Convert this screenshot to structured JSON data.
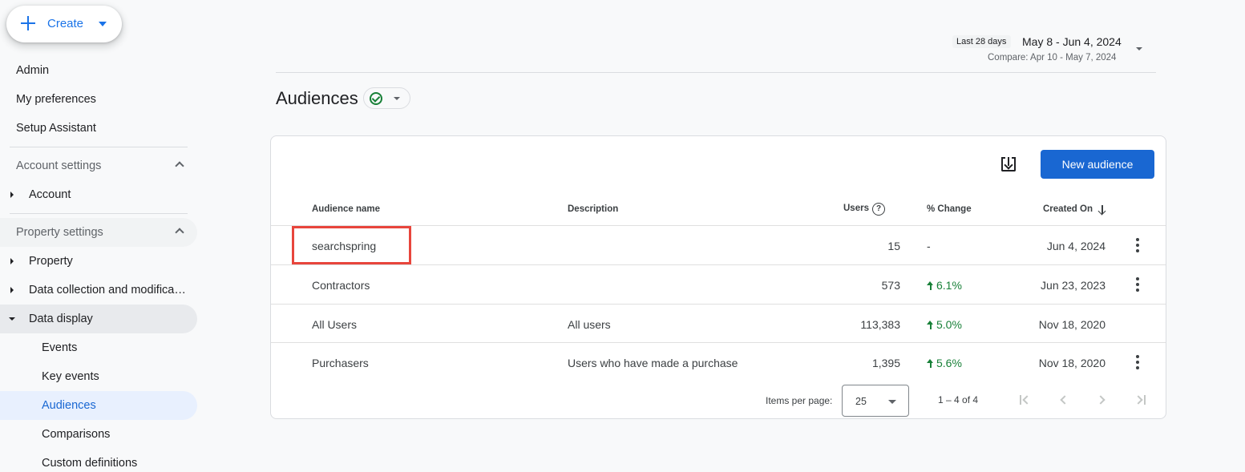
{
  "create": {
    "label": "Create"
  },
  "sidebar": {
    "top_items": [
      "Admin",
      "My preferences",
      "Setup Assistant"
    ],
    "account_settings": {
      "label": "Account settings",
      "items": [
        "Account"
      ]
    },
    "property_settings": {
      "label": "Property settings",
      "items": [
        "Property",
        "Data collection and modifica…",
        "Data display"
      ],
      "data_display_items": [
        "Events",
        "Key events",
        "Audiences",
        "Comparisons",
        "Custom definitions"
      ]
    }
  },
  "date": {
    "chip": "Last 28 days",
    "range": "May 8 - Jun 4, 2024",
    "compare": "Compare: Apr 10 - May 7, 2024"
  },
  "page": {
    "title": "Audiences"
  },
  "card": {
    "new_button": "New audience",
    "columns": {
      "name": "Audience name",
      "description": "Description",
      "users": "Users",
      "change": "% Change",
      "created": "Created On"
    },
    "help_glyph": "?",
    "rows": [
      {
        "name": "searchspring",
        "description": "",
        "users": "15",
        "change": "-",
        "created": "Jun 4, 2024"
      },
      {
        "name": "Contractors",
        "description": "",
        "users": "573",
        "change": "6.1%",
        "created": "Jun 23, 2023"
      },
      {
        "name": "All Users",
        "description": "All users",
        "users": "113,383",
        "change": "5.0%",
        "created": "Nov 18, 2020"
      },
      {
        "name": "Purchasers",
        "description": "Users who have made a purchase",
        "users": "1,395",
        "change": "5.6%",
        "created": "Nov 18, 2020"
      }
    ],
    "pagination": {
      "items_per_page_label": "Items per page:",
      "items_per_page_value": "25",
      "range": "1 – 4 of 4"
    }
  },
  "colors": {
    "accent": "#1a73e8",
    "primary_button": "#1967d2",
    "positive": "#188038",
    "highlight_box": "#e8453c"
  },
  "icons": [
    "plus-icon",
    "caret-down-icon",
    "chevron-up-icon",
    "triangle-right-icon",
    "triangle-down-icon",
    "check-circle-icon",
    "download-icon",
    "help-icon",
    "arrow-down-icon",
    "arrow-up-icon",
    "more-vert-icon",
    "first-page-icon",
    "prev-page-icon",
    "next-page-icon",
    "last-page-icon"
  ]
}
